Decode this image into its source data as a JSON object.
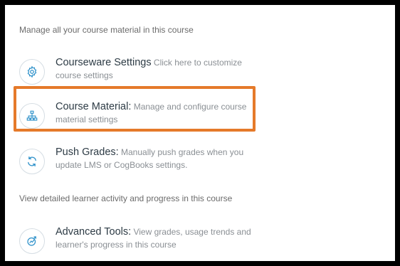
{
  "sections": {
    "manage_heading": "Manage all your course material in this course",
    "activity_heading": "View detailed learner activity and progress in this course"
  },
  "items": [
    {
      "title": "Courseware Settings",
      "description": " Click here to customize course settings",
      "icon": "gear-icon"
    },
    {
      "title": "Course Material:",
      "description": " Manage and configure course material settings",
      "icon": "hierarchy-icon"
    },
    {
      "title": "Push Grades:",
      "description": " Manually push grades when you update LMS or CogBooks settings.",
      "icon": "refresh-icon"
    },
    {
      "title": "Advanced Tools:",
      "description": " View grades, usage trends and learner's progress in this course",
      "icon": "analytics-icon"
    }
  ],
  "colors": {
    "icon": "#2a8fc9",
    "highlight": "#e57a2a",
    "title": "#2d3b45",
    "muted": "#8a8f94"
  }
}
